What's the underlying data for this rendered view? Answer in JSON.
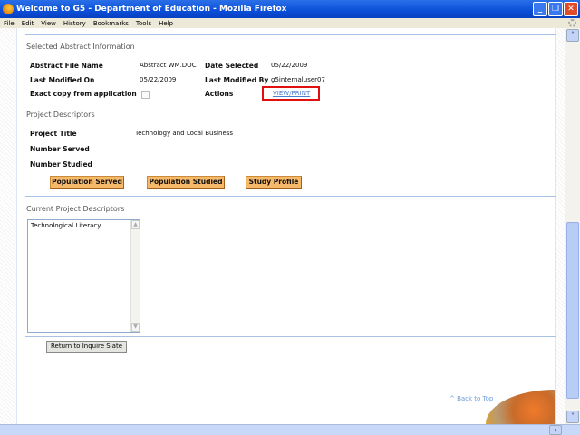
{
  "window": {
    "title": "Welcome to G5 - Department of Education - Mozilla Firefox"
  },
  "menu": [
    "File",
    "Edit",
    "View",
    "History",
    "Bookmarks",
    "Tools",
    "Help"
  ],
  "abstract": {
    "heading": "Selected Abstract Information",
    "file_name_label": "Abstract File Name",
    "file_name": "Abstract WM.DOC",
    "date_selected_label": "Date Selected",
    "date_selected": "05/22/2009",
    "last_modified_on_label": "Last Modified On",
    "last_modified_on": "05/22/2009",
    "last_modified_by_label": "Last Modified By",
    "last_modified_by": "g5internaluser07",
    "exact_copy_label": "Exact copy from application",
    "exact_copy_checked": false,
    "actions_label": "Actions",
    "view_print": "VIEW/PRINT"
  },
  "descriptors": {
    "heading": "Project Descriptors",
    "project_title_label": "Project Title",
    "project_title": "Technology and Local Business",
    "number_served_label": "Number Served",
    "number_studied_label": "Number Studied",
    "buttons": [
      "Population Served",
      "Population Studied",
      "Study Profile"
    ]
  },
  "current": {
    "heading": "Current Project Descriptors",
    "items": [
      "Technological Literacy"
    ]
  },
  "return_button": "Return to Inquire Slate",
  "back_to_top": "^ Back to Top"
}
